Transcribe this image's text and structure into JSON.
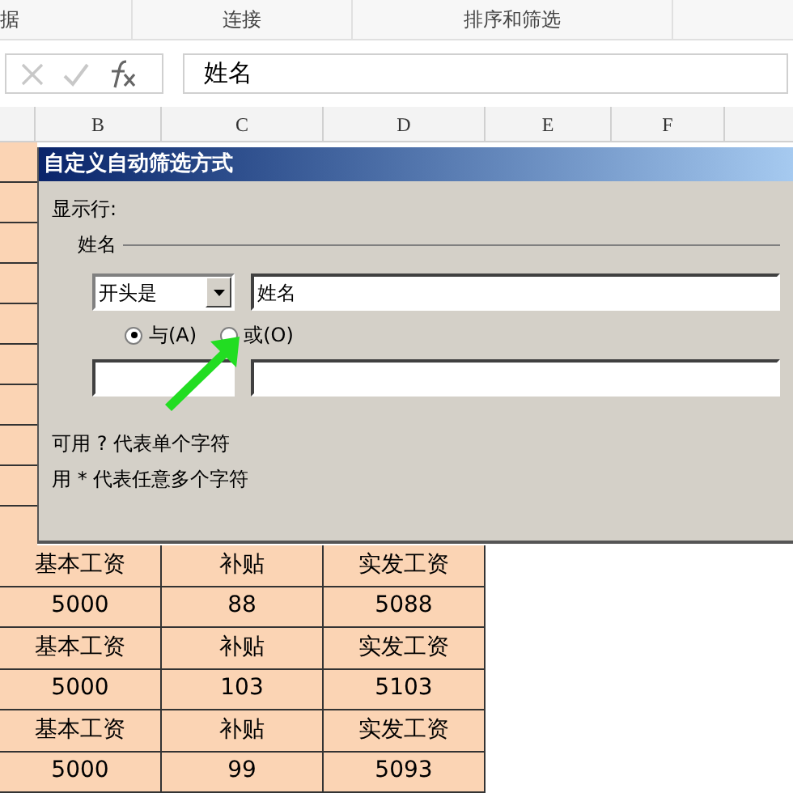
{
  "ribbon_groups": [
    "据",
    "连接",
    "排序和筛选"
  ],
  "formula_bar": {
    "value": "姓名"
  },
  "column_headers": [
    "B",
    "C",
    "D",
    "E",
    "F"
  ],
  "dialog": {
    "title": "自定义自动筛选方式",
    "show_rows_label": "显示行:",
    "field_label": "姓名",
    "condition": {
      "operator": "开头是",
      "value": "姓名"
    },
    "logic": [
      {
        "label": "与(A)",
        "selected": true
      },
      {
        "label": "或(O)",
        "selected": false
      }
    ],
    "hints": [
      "可用 ? 代表单个字符",
      "用 * 代表任意多个字符"
    ]
  },
  "rows": [
    {
      "cells": [
        "基本工资",
        "补贴",
        "实发工资"
      ]
    },
    {
      "cells": [
        "5000",
        "88",
        "5088"
      ]
    },
    {
      "cells": [
        "基本工资",
        "补贴",
        "实发工资"
      ]
    },
    {
      "cells": [
        "5000",
        "103",
        "5103"
      ]
    },
    {
      "cells": [
        "基本工资",
        "补贴",
        "实发工资"
      ]
    },
    {
      "cells": [
        "5000",
        "99",
        "5093"
      ]
    }
  ]
}
